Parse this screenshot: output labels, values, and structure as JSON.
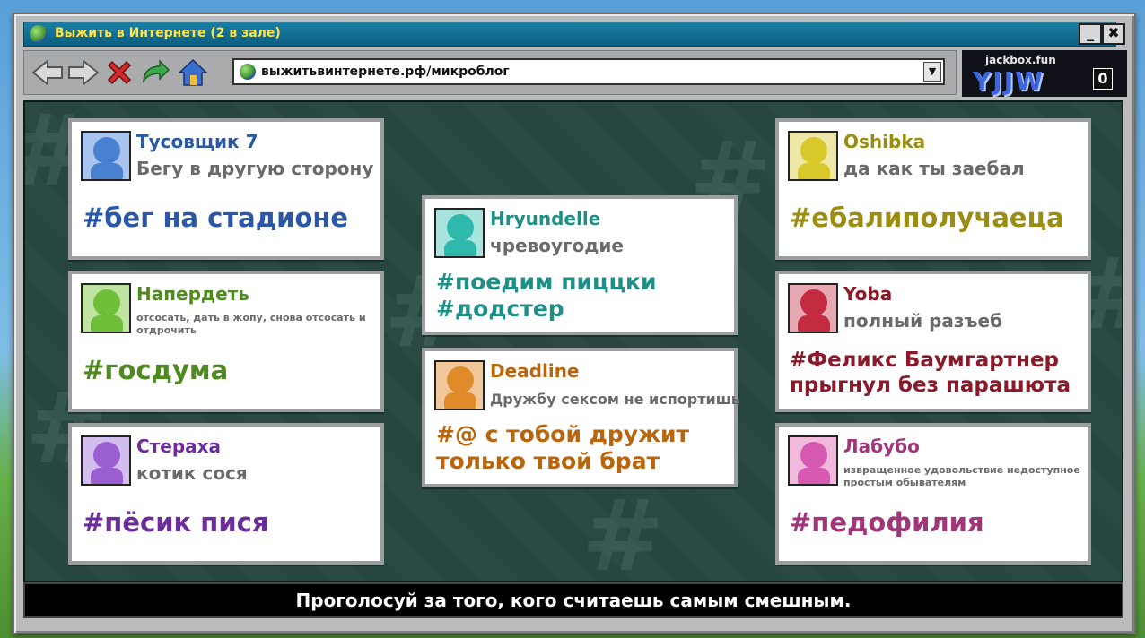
{
  "window": {
    "title": "Выжить в Интернете  (2 в зале)"
  },
  "controls": {
    "minimize": "_",
    "close": "✖"
  },
  "navigation": {
    "icons": [
      "back-arrow-icon",
      "forward-arrow-icon",
      "stop-icon",
      "refresh-icon",
      "home-icon"
    ],
    "url": "выжитьвинтернете.рф/микроблог",
    "dropdown": "▼"
  },
  "logo": {
    "site": "jackbox.fun",
    "room_code": "YJJW",
    "count": "0"
  },
  "cards": [
    {
      "name": "Тусовщик 7",
      "status": "Бегу в другую сторону",
      "tag": "#бег на стадионе",
      "color": "#2a58a6",
      "avatar": "#4a80d0"
    },
    {
      "name": "Напердеть",
      "status": "отсосать, дать в жопу, снова отсосать и отдрочить",
      "tag": "#госдума",
      "color": "#4f8a1e",
      "avatar": "#6fbf3a"
    },
    {
      "name": "Стераха",
      "status": "котик сося",
      "tag": "#пёсик пися",
      "color": "#6a2d9a",
      "avatar": "#9a5fd0"
    },
    {
      "name": "Hryundelle",
      "status": "чревоугодие",
      "tag": "#поедим пиццки #додстер",
      "color": "#1e8f86",
      "avatar": "#2fb9ad"
    },
    {
      "name": "Deadline",
      "status": "Дружбу сексом не испортишь",
      "tag": "#@ с тобой дружит только твой брат",
      "color": "#b8650e",
      "avatar": "#e08a2a"
    },
    {
      "name": "Oshibka",
      "status": "да как ты заебал",
      "tag": "#ебалиполучаеца",
      "color": "#9a8d12",
      "avatar": "#d8c82a"
    },
    {
      "name": "Yoba",
      "status": "полный разъеб",
      "tag": "#Феликс Баумгартнер прыгнул без парашюта",
      "color": "#8a1a2a",
      "avatar": "#c42a40"
    },
    {
      "name": "Лабубо",
      "status": "извращенное удовольствие недоступное простым обывателям",
      "tag": "#педофилия",
      "color": "#a0357a",
      "avatar": "#d65ab0"
    }
  ],
  "footer": {
    "instruction": "Проголосуй за того, кого считаешь самым смешным."
  }
}
